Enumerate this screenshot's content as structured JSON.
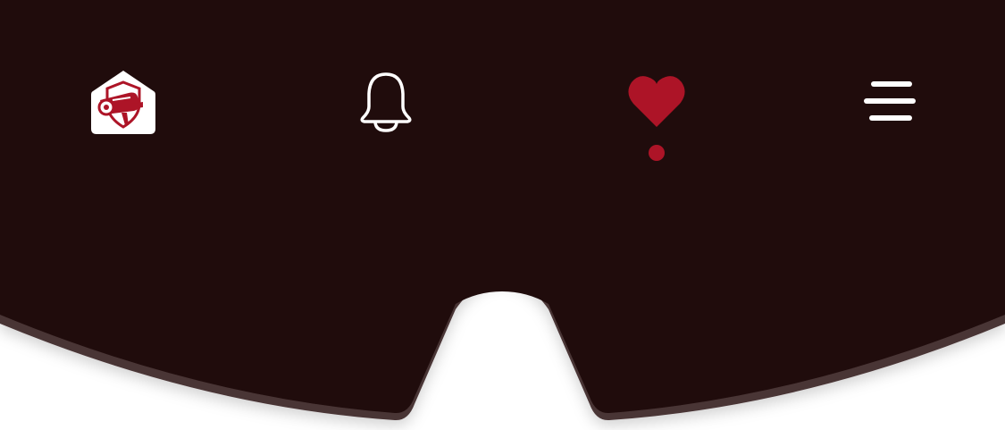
{
  "colors": {
    "bar_background": "#200c0c",
    "bar_edge": "#4a3436",
    "page_background": "#ffffff",
    "accent": "#ad1427",
    "icon_default": "#ffffff"
  },
  "nav": {
    "active_item": "favorites",
    "items": [
      {
        "id": "home",
        "icon": "security-camera-shield-home-icon"
      },
      {
        "id": "notifications",
        "icon": "bell-icon"
      },
      {
        "id": "favorites",
        "icon": "heart-icon"
      },
      {
        "id": "menu",
        "icon": "hamburger-menu-icon"
      }
    ]
  }
}
